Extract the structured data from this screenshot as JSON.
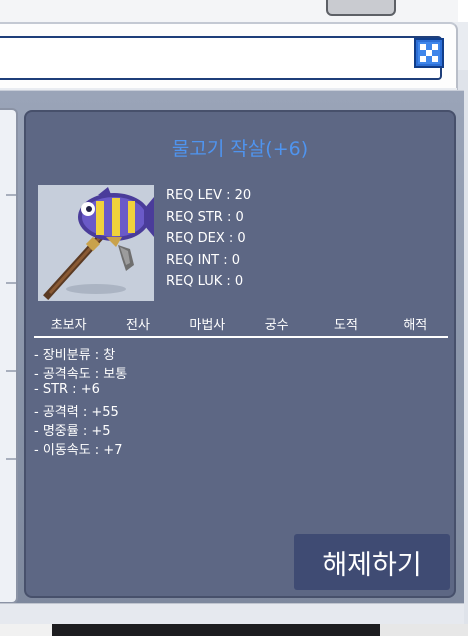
{
  "item": {
    "name": "물고기 작살(+6)",
    "icon": "fish-spear-icon",
    "requirements": [
      {
        "label": "REQ LEV",
        "value": "20"
      },
      {
        "label": "REQ STR",
        "value": "0"
      },
      {
        "label": "REQ DEX",
        "value": "0"
      },
      {
        "label": "REQ INT",
        "value": "0"
      },
      {
        "label": "REQ LUK",
        "value": "0"
      }
    ],
    "classes": [
      "초보자",
      "전사",
      "마법사",
      "궁수",
      "도적",
      "해적"
    ],
    "stats": [
      "- 장비분류 : 창",
      "- 공격속도 : 보통",
      "- STR : +6",
      "- 공격력 : +55",
      "- 명중률 : +5",
      "- 이동속도 : +7"
    ],
    "release_label": "해제하기"
  },
  "colors": {
    "panel_bg": "#5d6784",
    "title": "#4f94ef",
    "button_bg": "#3f4b73"
  }
}
